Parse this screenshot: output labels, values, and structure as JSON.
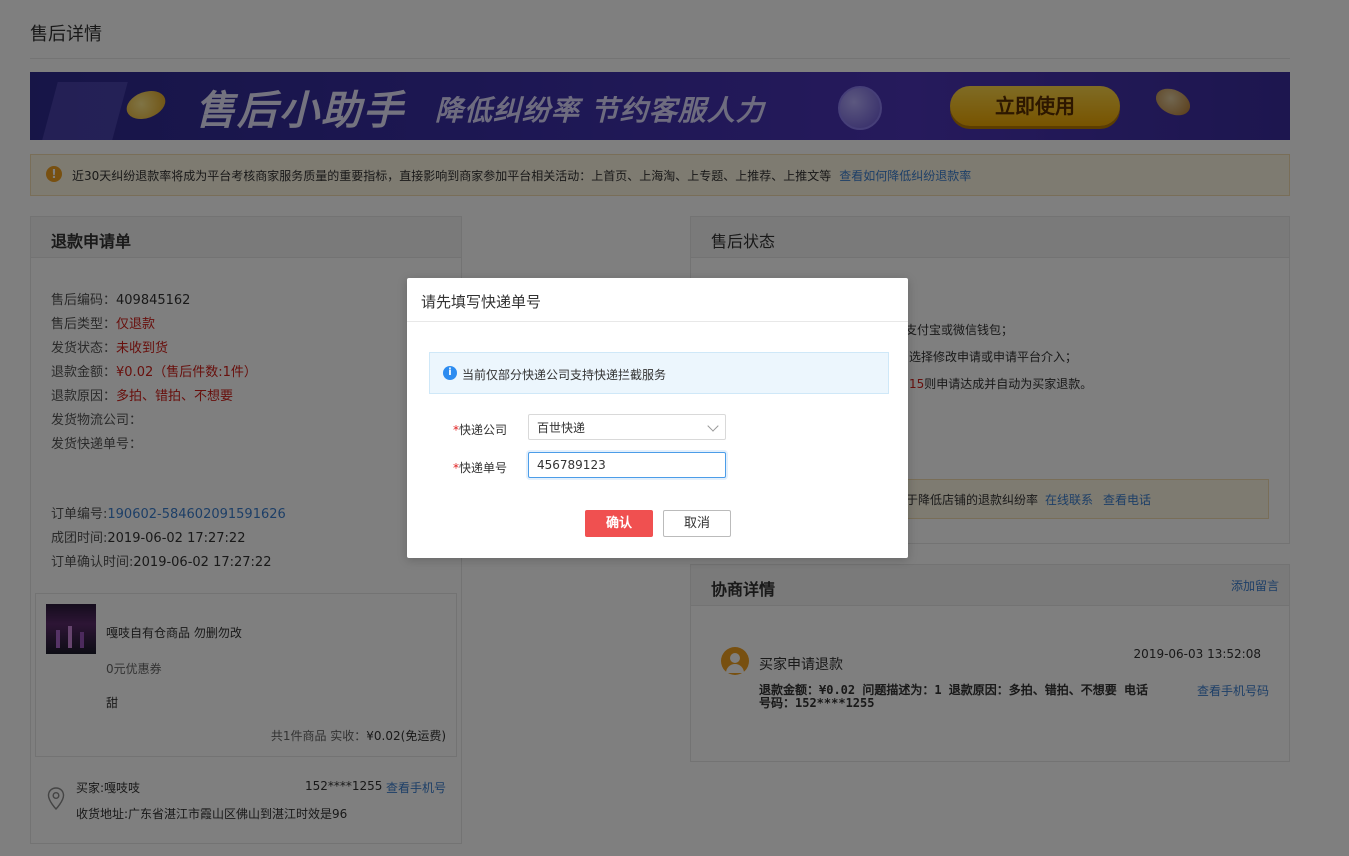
{
  "page": {
    "title": "售后详情"
  },
  "banner": {
    "main_text": "售后小助手",
    "sub_text": "降低纠纷率 节约客服人力",
    "button_label": "立即使用",
    "colors": {
      "background": "#3b2fa8",
      "button": "#f5c518"
    }
  },
  "notice": {
    "text": "近30天纠纷退款率将成为平台考核商家服务质量的重要指标，直接影响到商家参加平台相关活动：上首页、上海淘、上专题、上推荐、上推文等",
    "link": "查看如何降低纠纷退款率"
  },
  "refund_form": {
    "title": "退款申请单",
    "fields": [
      {
        "label": "售后编码：",
        "value": "409845162",
        "color": "normal"
      },
      {
        "label": "售后类型：",
        "value": "仅退款",
        "color": "red"
      },
      {
        "label": "发货状态：",
        "value": "未收到货",
        "color": "red"
      },
      {
        "label": "退款金额：",
        "value": "¥0.02（售后件数:1件）",
        "color": "red"
      },
      {
        "label": "退款原因：",
        "value": "多拍、错拍、不想要",
        "color": "red"
      },
      {
        "label": "发货物流公司：",
        "value": "",
        "color": "normal"
      },
      {
        "label": "发货快递单号：",
        "value": "",
        "color": "normal"
      }
    ],
    "order": [
      {
        "label": "订单编号:",
        "value": "190602-584602091591626",
        "color": "blue"
      },
      {
        "label": "成团时间:",
        "value": "2019-06-02 17:27:22",
        "color": "normal"
      },
      {
        "label": "订单确认时间:",
        "value": "2019-06-02 17:27:22",
        "color": "normal"
      }
    ],
    "product": {
      "name": "嘎吱自有仓商品 勿删勿改",
      "coupon": "0元优惠券",
      "spec": "甜",
      "summary_prefix": "共1件商品   实收：",
      "amount": "¥0.02(免运费)"
    },
    "buyer": {
      "name": "买家:嘎吱吱",
      "phone": "152****1255",
      "phone_link": "查看手机号",
      "address": "收货地址:广东省湛江市霞山区佛山到湛江时效是96"
    }
  },
  "aftersale_status": {
    "title": "售后状态",
    "line1": "支付宝或微信钱包；",
    "line2": "选择修改申请或申请平台介入；",
    "line3_red": "15",
    "line3_rest": "则申请达成并自动为买家退款。",
    "notice_text": "于降低店铺的退款纠纷率",
    "link_online": "在线联系",
    "link_phone": "查看电话"
  },
  "negotiation": {
    "title": "协商详情",
    "add_link": "添加留言",
    "entry": {
      "title": "买家申请退款",
      "time": "2019-06-03 13:52:08",
      "detail": "退款金额：¥0.02 问题描述为：1 退款原因：多拍、错拍、不想要 电话号码：152****1255",
      "phone_link": "查看手机号码"
    }
  },
  "modal": {
    "title": "请先填写快递单号",
    "info": "当前仅部分快递公司支持快递拦截服务",
    "company_label": "快递公司",
    "company_value": "百世快递",
    "tracking_label": "快递单号",
    "tracking_value": "456789123",
    "confirm": "确认",
    "cancel": "取消",
    "colors": {
      "confirm": "#f05050",
      "info_icon": "#2d8cf0"
    }
  }
}
